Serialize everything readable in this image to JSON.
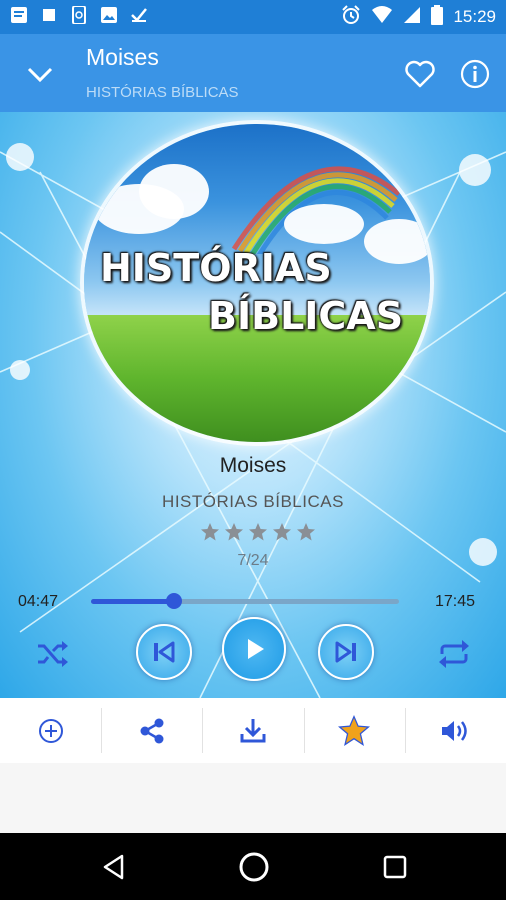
{
  "status_bar": {
    "time": "15:29",
    "left_icons": [
      "message-icon",
      "square-icon",
      "phone-sync-icon",
      "image-icon",
      "task-check-icon"
    ],
    "right_icons": [
      "alarm-icon",
      "wifi-icon",
      "signal-icon",
      "battery-icon"
    ]
  },
  "app_bar": {
    "title": "Moises",
    "subtitle": "HISTÓRIAS BÍBLICAS"
  },
  "cover_art": {
    "line1": "HISTÓRIAS",
    "line2": "BÍBLICAS"
  },
  "track": {
    "title": "Moises",
    "artist": "HISTÓRIAS BÍBLICAS",
    "rating": 0,
    "max_rating": 5,
    "position_label": "7/24"
  },
  "playback": {
    "elapsed": "04:47",
    "duration": "17:45",
    "progress": 0.27
  },
  "controls": [
    "shuffle-icon",
    "previous-icon",
    "play-icon",
    "next-icon",
    "repeat-icon"
  ],
  "actions": [
    "add-circle-icon",
    "share-icon",
    "download-icon",
    "star-icon",
    "volume-icon"
  ],
  "colors": {
    "status_bar": "#1f7fd6",
    "app_bar": "#3a94e6",
    "accent": "#2f57d8",
    "play_button": "#1e9be6",
    "star_active": "#f0a21b"
  }
}
